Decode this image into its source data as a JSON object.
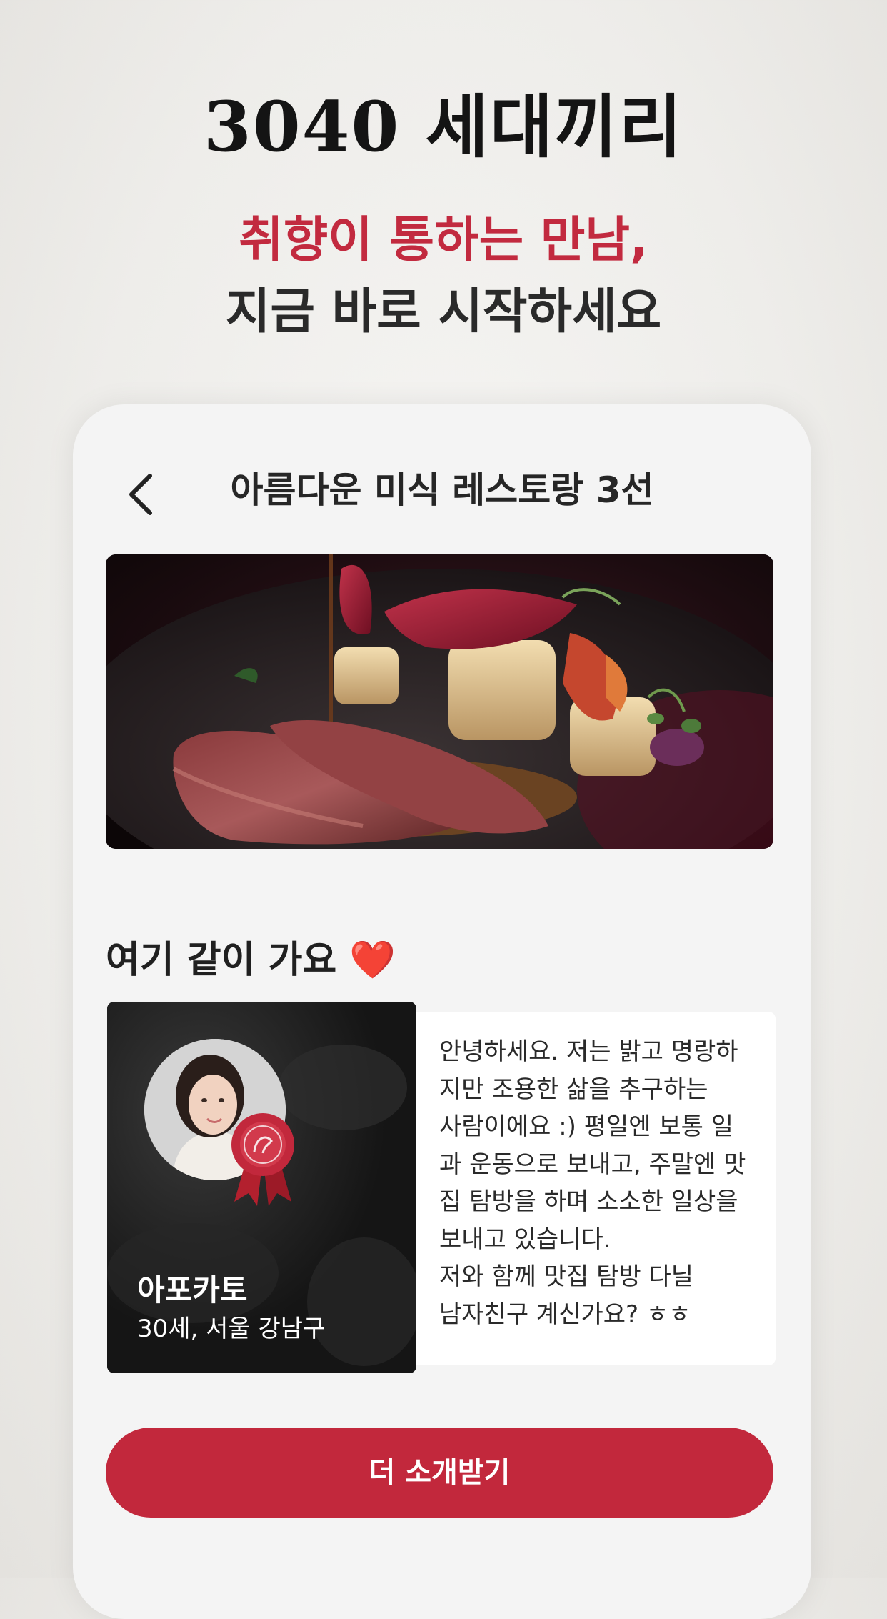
{
  "hero": {
    "title": "3040 세대끼리",
    "subtitle_highlight": "취향이 통하는 만남,",
    "subtitle": "지금 바로 시작하세요"
  },
  "screen": {
    "nav": {
      "back_icon": "chevron-left-icon",
      "title": "아름다운 미식 레스토랑 3선"
    },
    "section_title": "여기 같이 가요 ❤️",
    "profile": {
      "name": "아포카토",
      "meta": "30세, 서울 강남구",
      "bio": "안녕하세요. 저는 밝고 명랑하\n지만 조용한 삶을 추구하는\n사람이에요 :) 평일엔 보통 일\n과 운동으로 보내고, 주말엔 맛\n집 탐방을 하며 소소한 일상을\n보내고 있습니다.\n저와 함께 맛집 탐방 다닐\n남자친구 계신가요? ㅎㅎ",
      "badge_icon": "wax-seal-ribbon-icon"
    },
    "cta_label": "더 소개받기"
  },
  "colors": {
    "accent": "#c2283c",
    "card_bg": "#f4f4f4",
    "text_dark": "#1e1e1e"
  }
}
